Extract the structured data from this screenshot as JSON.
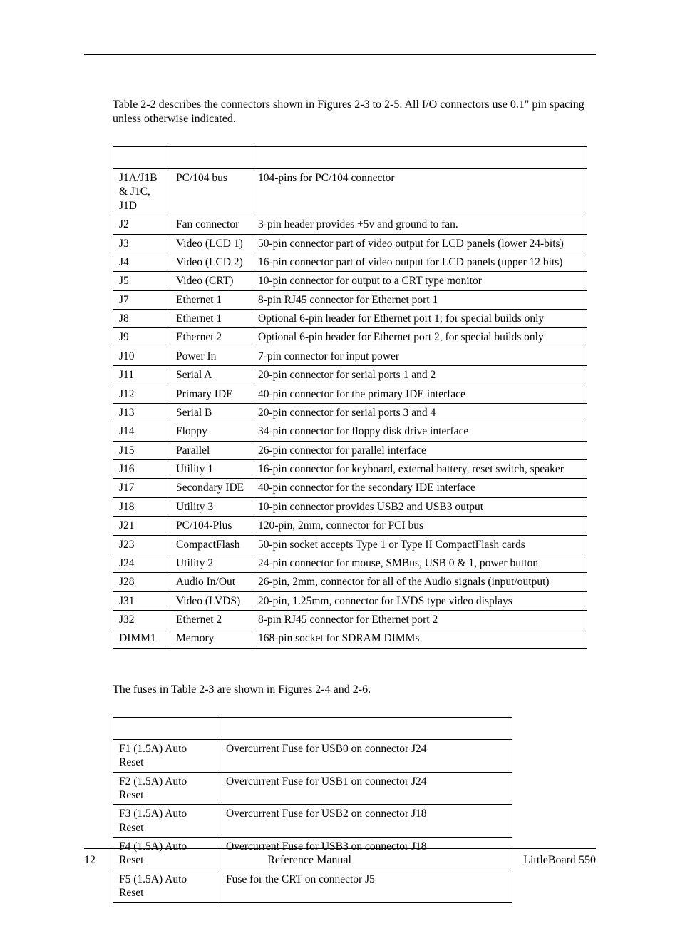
{
  "intro1": "Table 2-2 describes the connectors shown in Figures 2-3 to 2-5.  All I/O connectors use 0.1\" pin spacing unless otherwise indicated.",
  "intro2": "The fuses in Table 2-3 are shown in Figures 2-4 and 2-6.",
  "table22": {
    "rows": [
      {
        "c1": "J1A/J1B & J1C, J1D",
        "c2": "PC/104 bus",
        "c3": "104-pins for PC/104 connector"
      },
      {
        "c1": "J2",
        "c2": "Fan connector",
        "c3": "3-pin header provides +5v and ground to fan."
      },
      {
        "c1": "J3",
        "c2": "Video (LCD 1)",
        "c3": "50-pin connector part of video output for LCD panels (lower 24-bits)"
      },
      {
        "c1": "J4",
        "c2": "Video (LCD 2)",
        "c3": "16-pin connector part of video output for LCD panels (upper 12 bits)"
      },
      {
        "c1": "J5",
        "c2": "Video (CRT)",
        "c3": "10-pin connector for output to a CRT type monitor"
      },
      {
        "c1": "J7",
        "c2": "Ethernet 1",
        "c3": "8-pin RJ45 connector for Ethernet port 1"
      },
      {
        "c1": "J8",
        "c2": "Ethernet 1",
        "c3": "Optional 6-pin header for Ethernet port 1; for special builds only"
      },
      {
        "c1": "J9",
        "c2": "Ethernet 2",
        "c3": "Optional 6-pin header for Ethernet port 2, for special builds only"
      },
      {
        "c1": "J10",
        "c2": "Power In",
        "c3": "7-pin connector for input power"
      },
      {
        "c1": "J11",
        "c2": "Serial A",
        "c3": "20-pin connector for serial ports 1 and 2"
      },
      {
        "c1": "J12",
        "c2": "Primary IDE",
        "c3": "40-pin connector for the primary IDE interface"
      },
      {
        "c1": "J13",
        "c2": "Serial B",
        "c3": "20-pin connector for serial ports 3 and 4"
      },
      {
        "c1": "J14",
        "c2": "Floppy",
        "c3": "34-pin connector for floppy disk drive interface"
      },
      {
        "c1": "J15",
        "c2": "Parallel",
        "c3": "26-pin connector for parallel interface"
      },
      {
        "c1": "J16",
        "c2": "Utility 1",
        "c3": "16-pin connector for keyboard, external battery, reset switch, speaker"
      },
      {
        "c1": "J17",
        "c2": "Secondary IDE",
        "c3": "40-pin connector for the secondary IDE interface"
      },
      {
        "c1": "J18",
        "c2": "Utility 3",
        "c3": "10-pin connector provides USB2 and USB3 output"
      },
      {
        "c1": "J21",
        "c2": "PC/104-Plus",
        "c3": "120-pin, 2mm, connector for PCI bus"
      },
      {
        "c1": "J23",
        "c2": "CompactFlash",
        "c3": "50-pin socket accepts Type 1 or Type II CompactFlash cards"
      },
      {
        "c1": "J24",
        "c2": "Utility 2",
        "c3": "24-pin connector for mouse, SMBus, USB 0 & 1, power button"
      },
      {
        "c1": "J28",
        "c2": "Audio In/Out",
        "c3": "26-pin, 2mm, connector for all of the Audio signals (input/output)"
      },
      {
        "c1": "J31",
        "c2": "Video (LVDS)",
        "c3": "20-pin, 1.25mm, connector for LVDS type video displays"
      },
      {
        "c1": "J32",
        "c2": "Ethernet 2",
        "c3": "8-pin RJ45 connector for Ethernet port 2"
      },
      {
        "c1": "DIMM1",
        "c2": "Memory",
        "c3": "168-pin socket for SDRAM DIMMs"
      }
    ]
  },
  "table23": {
    "rows": [
      {
        "c1": "F1 (1.5A) Auto Reset",
        "c2": "Overcurrent Fuse for USB0 on connector J24"
      },
      {
        "c1": "F2 (1.5A) Auto Reset",
        "c2": "Overcurrent Fuse for USB1 on connector J24"
      },
      {
        "c1": "F3 (1.5A) Auto Reset",
        "c2": "Overcurrent Fuse for USB2 on connector J18"
      },
      {
        "c1": "F4 (1.5A) Auto Reset",
        "c2": "Overcurrent Fuse for USB3 on connector J18"
      },
      {
        "c1": "F5 (1.5A) Auto Reset",
        "c2": "Fuse for the CRT on connector J5"
      }
    ]
  },
  "footer": {
    "left": "12",
    "center": "Reference Manual",
    "right": "LittleBoard 550"
  }
}
